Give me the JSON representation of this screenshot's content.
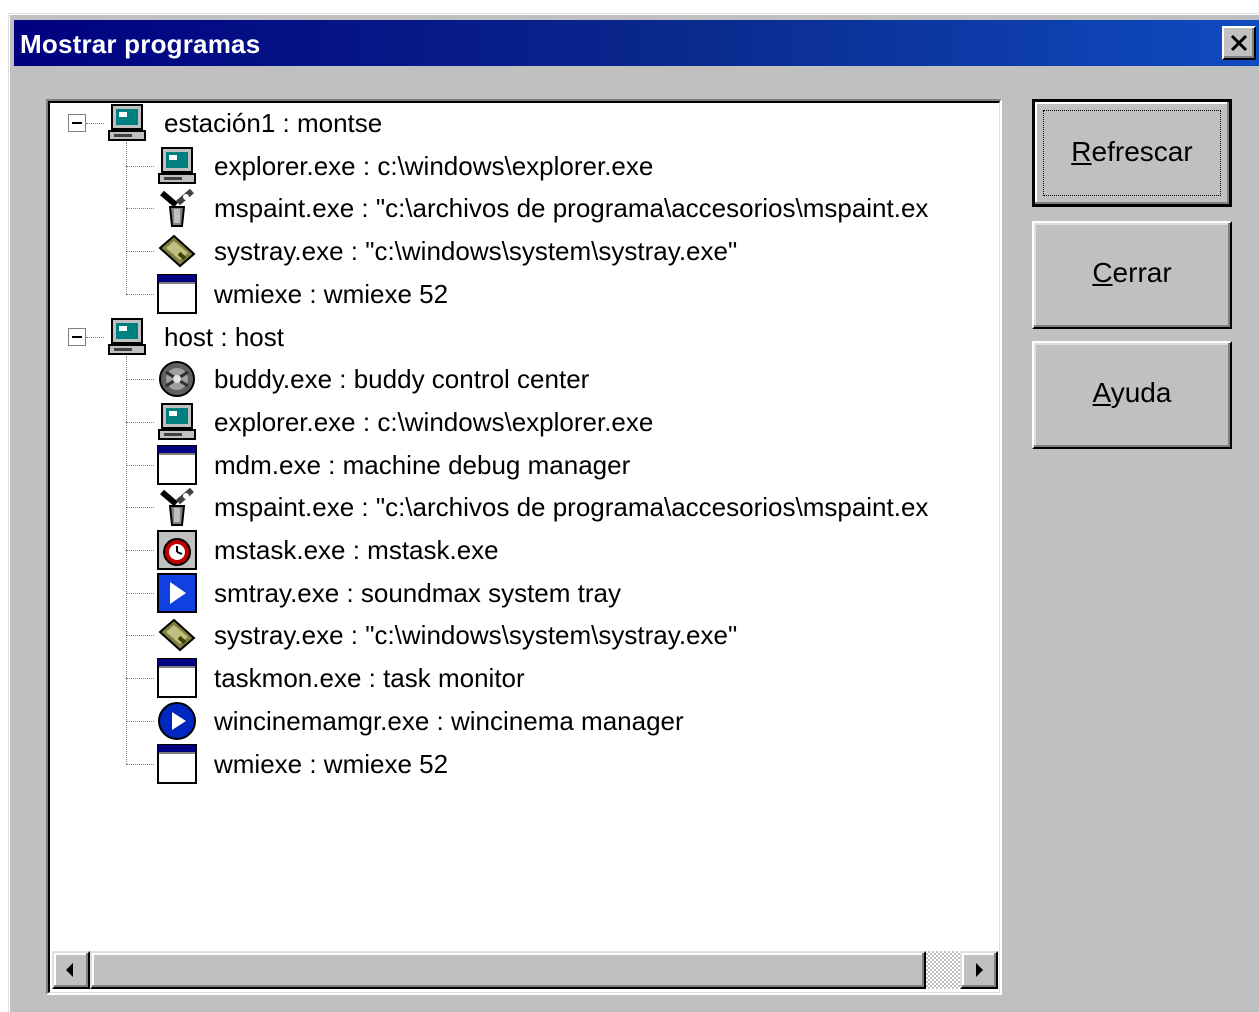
{
  "window": {
    "title": "Mostrar programas",
    "close_glyph": "✕",
    "colors": {
      "title_start": "#000080",
      "title_end": "#0f4bc0",
      "face": "#c0c0c0"
    }
  },
  "buttons": {
    "refresh": {
      "mnemonic": "R",
      "rest": "efrescar"
    },
    "close": {
      "mnemonic": "C",
      "rest": "errar"
    },
    "help": {
      "mnemonic": "A",
      "rest": "yuda"
    }
  },
  "tree": {
    "hosts": [
      {
        "label": "estación1 : montse",
        "icon": "computer-icon",
        "expanded": true,
        "children": [
          {
            "label": "explorer.exe : c:\\windows\\explorer.exe",
            "icon": "computer-icon"
          },
          {
            "label": "mspaint.exe : \"c:\\archivos de programa\\accesorios\\mspaint.ex",
            "icon": "paint-icon"
          },
          {
            "label": "systray.exe : \"c:\\windows\\system\\systray.exe\"",
            "icon": "systray-icon"
          },
          {
            "label": "wmiexe : wmiexe 52",
            "icon": "window-icon"
          }
        ]
      },
      {
        "label": "host : host",
        "icon": "computer-icon",
        "expanded": true,
        "children": [
          {
            "label": "buddy.exe : buddy control center",
            "icon": "buddy-icon"
          },
          {
            "label": "explorer.exe : c:\\windows\\explorer.exe",
            "icon": "computer-icon"
          },
          {
            "label": "mdm.exe : machine debug manager",
            "icon": "window-icon"
          },
          {
            "label": "mspaint.exe : \"c:\\archivos de programa\\accesorios\\mspaint.ex",
            "icon": "paint-icon"
          },
          {
            "label": "mstask.exe : mstask.exe",
            "icon": "mstask-icon"
          },
          {
            "label": "smtray.exe : soundmax system tray",
            "icon": "play-square-icon"
          },
          {
            "label": "systray.exe : \"c:\\windows\\system\\systray.exe\"",
            "icon": "systray-icon"
          },
          {
            "label": "taskmon.exe : task monitor",
            "icon": "window-icon"
          },
          {
            "label": "wincinemamgr.exe : wincinema manager",
            "icon": "play-circle-icon"
          },
          {
            "label": "wmiexe : wmiexe 52",
            "icon": "window-icon"
          }
        ]
      }
    ]
  },
  "scrollbar": {
    "left_arrow": "scroll-left-icon",
    "right_arrow": "scroll-right-icon"
  }
}
